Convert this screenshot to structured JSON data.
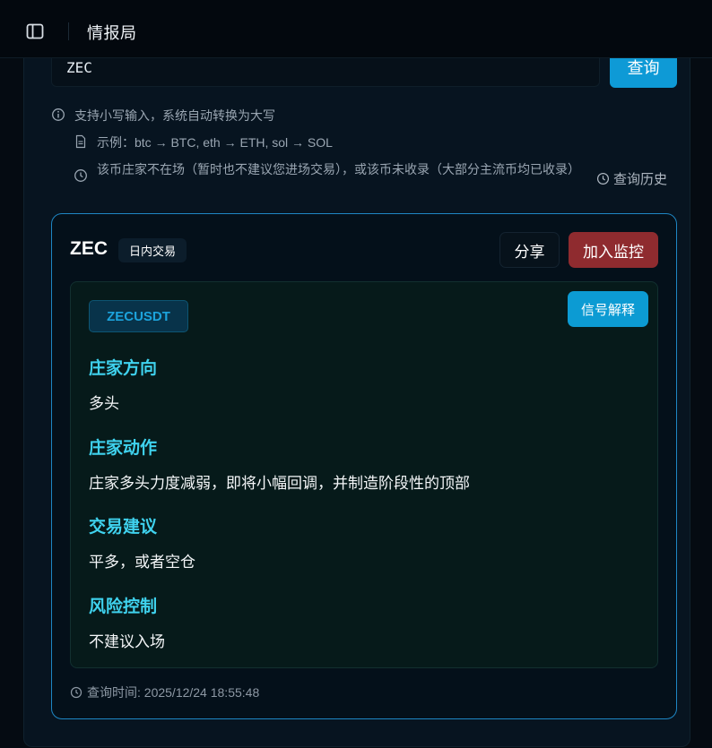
{
  "header": {
    "title": "情报局",
    "toggle_icon": "sidebar-toggle-icon"
  },
  "search": {
    "value": "ZEC",
    "button_label": "查询",
    "hints": {
      "case": "支持小写输入，系统自动转换为大写",
      "example": "示例：btc → BTC, eth → ETH, sol → SOL",
      "absent": "该币庄家不在场（暂时也不建议您进场交易），或该币未收录（大部分主流币均已收录）"
    },
    "history_label": "查询历史"
  },
  "result": {
    "symbol": "ZEC",
    "mode_tag": "日内交易",
    "share_label": "分享",
    "monitor_label": "加入监控",
    "pair": "ZECUSDT",
    "explain_label": "信号解释",
    "sections": [
      {
        "title": "庄家方向",
        "text": "多头"
      },
      {
        "title": "庄家动作",
        "text": "庄家多头力度减弱，即将小幅回调，并制造阶段性的顶部"
      },
      {
        "title": "交易建议",
        "text": "平多，或者空仓"
      },
      {
        "title": "风险控制",
        "text": "不建议入场"
      }
    ],
    "query_time": "查询时间: 2025/12/24 18:55:48"
  },
  "colors": {
    "accent_blue": "#0e9ad6",
    "danger_red": "#8f2b2f",
    "section_cyan": "#3fd2ee",
    "card_border": "#1e86c4"
  }
}
